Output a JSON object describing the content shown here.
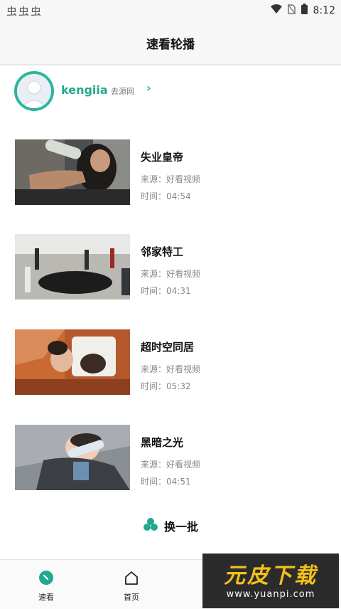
{
  "status_bar": {
    "left_icons": "虫虫虫",
    "time": "8:12"
  },
  "header": {
    "title": "速看轮播"
  },
  "profile": {
    "username": "kengiia",
    "link_label": "去源网"
  },
  "videos": [
    {
      "title": "失业皇帝",
      "source": "来源：好看视频",
      "time": "时间：04:54"
    },
    {
      "title": "邻家特工",
      "source": "来源：好看视频",
      "time": "时间：04:31"
    },
    {
      "title": "超时空同居",
      "source": "来源：好看视频",
      "time": "时间：05:32"
    },
    {
      "title": "黑暗之光",
      "source": "来源：好看视频",
      "time": "时间：04:51"
    }
  ],
  "refresh": {
    "label": "换一批",
    "icon": "clover-icon"
  },
  "tabs": [
    {
      "label": "速看",
      "icon": "speed-icon",
      "active": true
    },
    {
      "label": "首页",
      "icon": "home-icon",
      "active": false
    }
  ],
  "watermark": {
    "title": "元皮下载",
    "url": "www.yuanpi.com"
  },
  "colors": {
    "accent": "#23a98f",
    "watermark_yellow": "#f2c21b"
  }
}
